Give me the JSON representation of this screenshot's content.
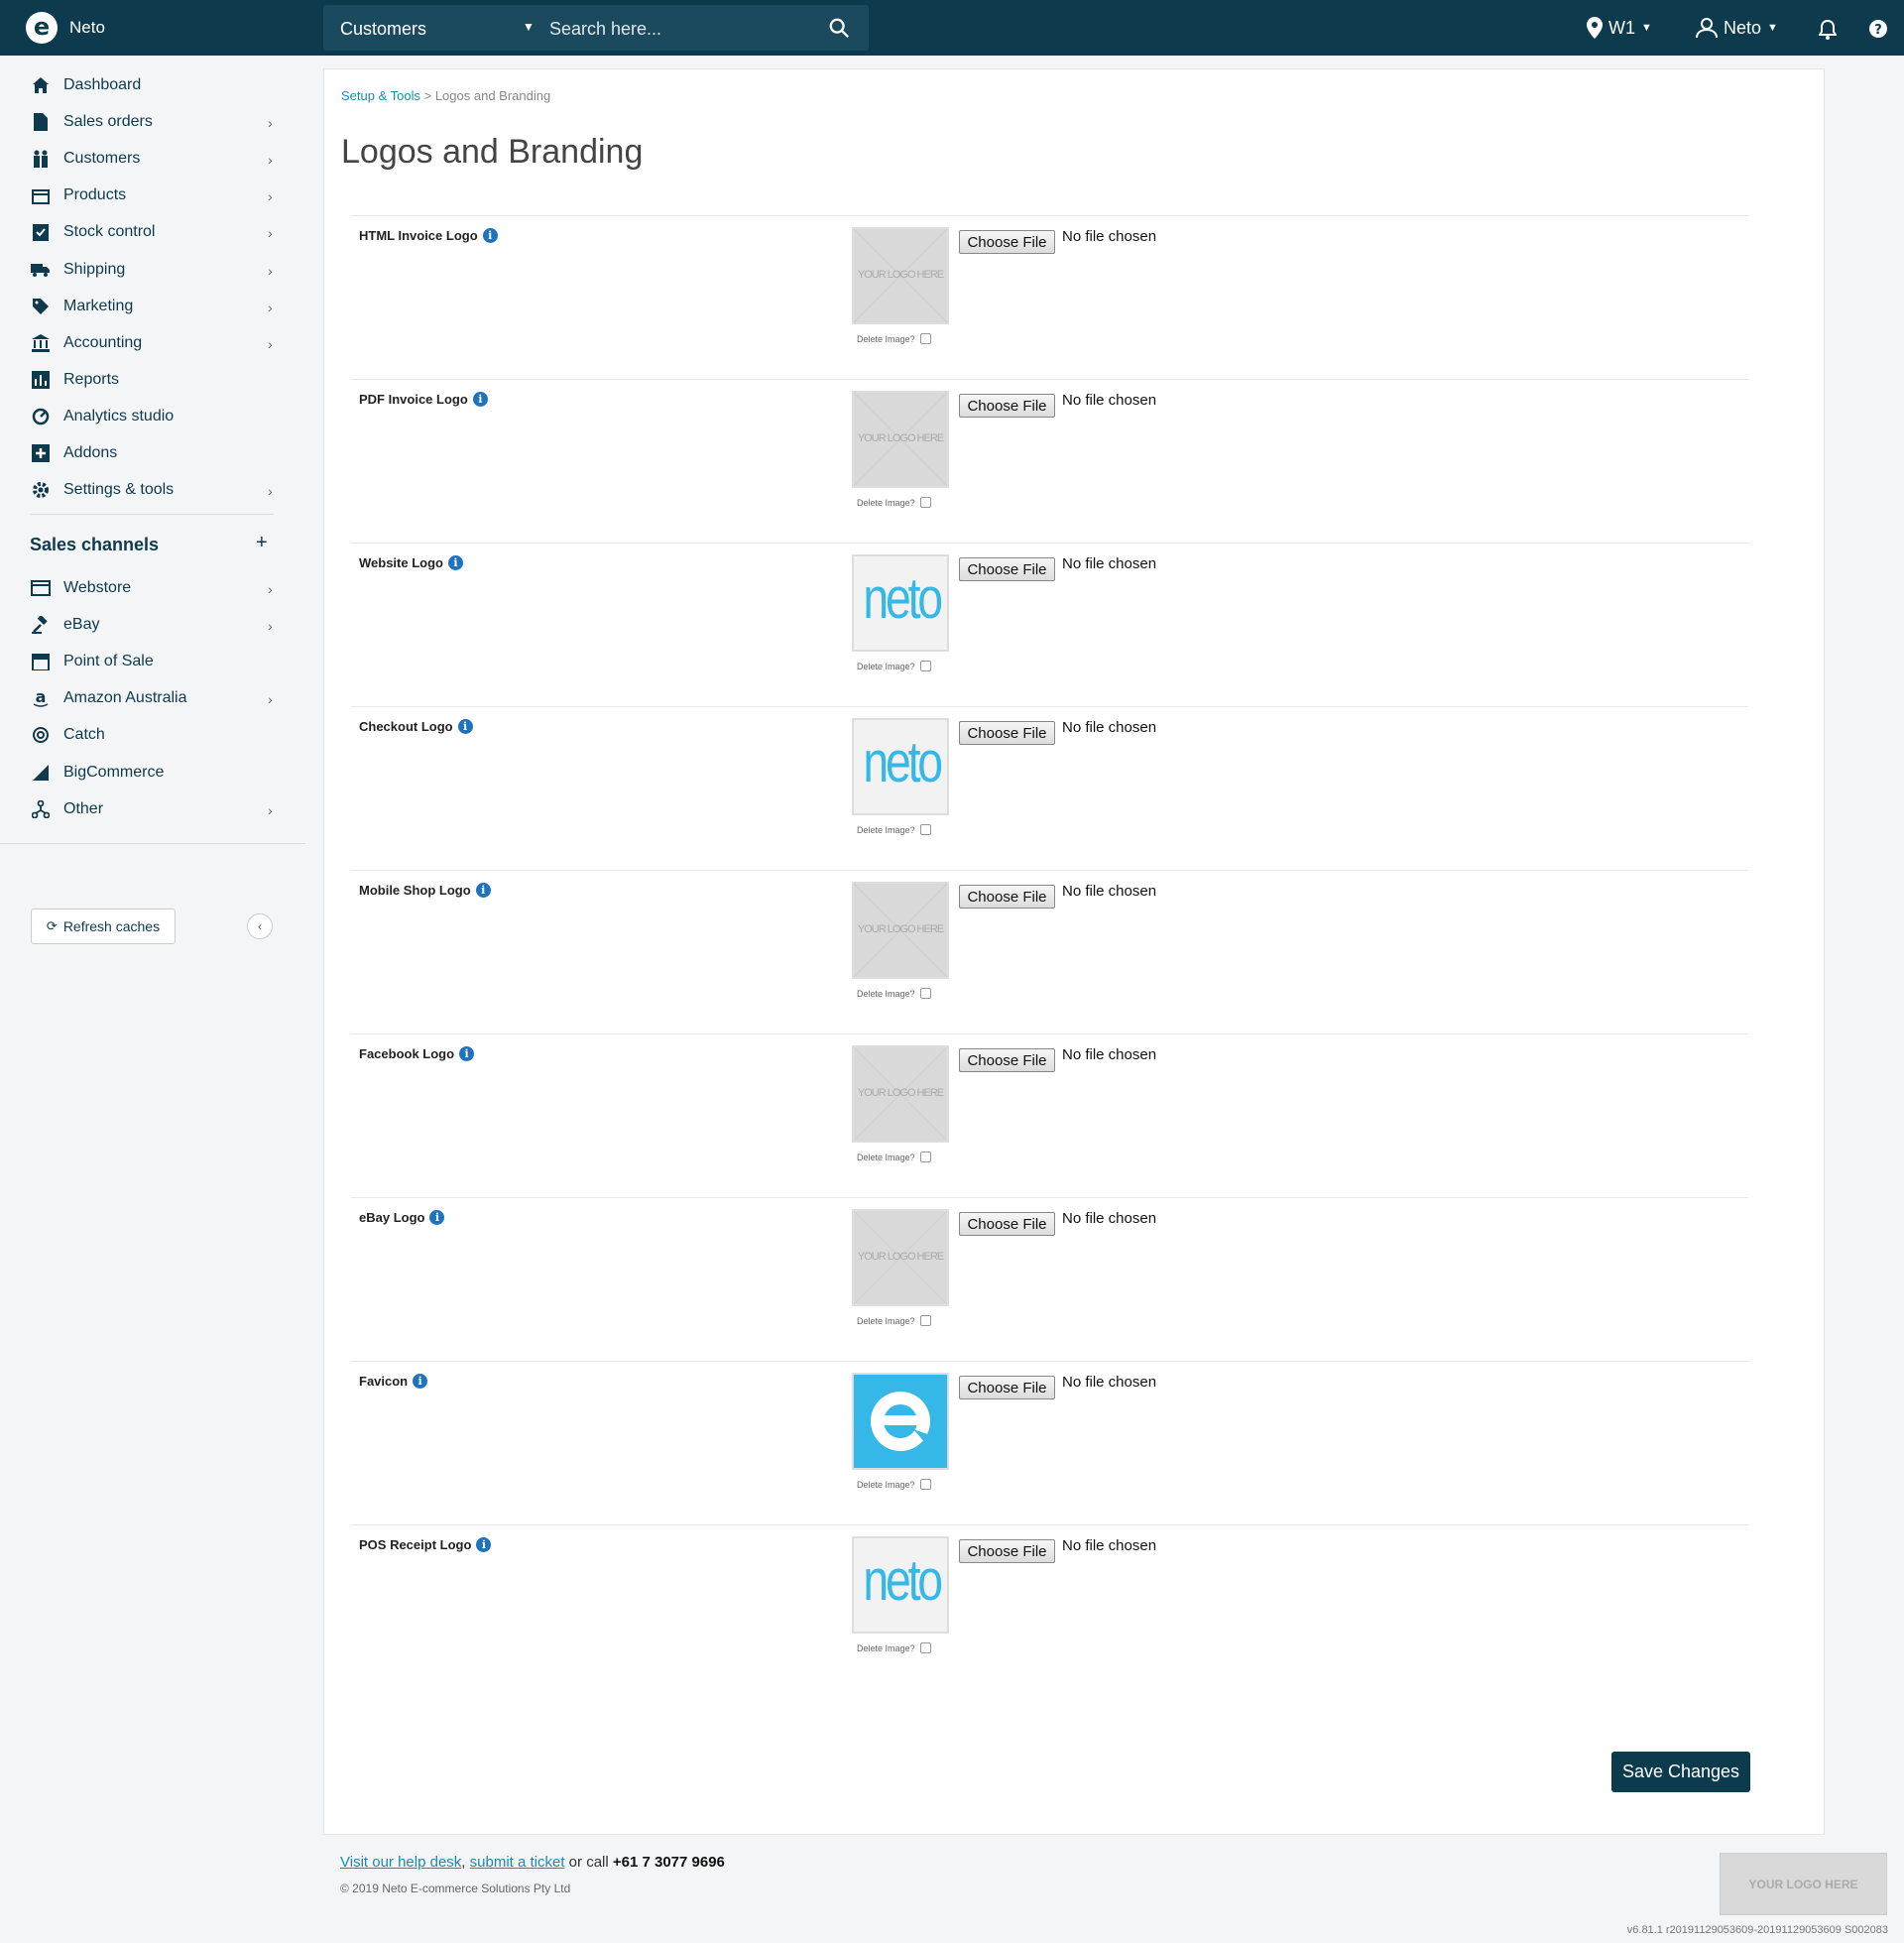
{
  "topbar": {
    "brand": "Neto",
    "search_scope": "Customers",
    "search_placeholder": "Search here...",
    "location": "W1",
    "user": "Neto"
  },
  "sidebar": {
    "items": [
      {
        "label": "Dashboard",
        "icon": "home-icon",
        "chevron": false
      },
      {
        "label": "Sales orders",
        "icon": "document-icon",
        "chevron": true
      },
      {
        "label": "Customers",
        "icon": "people-icon",
        "chevron": true
      },
      {
        "label": "Products",
        "icon": "box-icon",
        "chevron": true
      },
      {
        "label": "Stock control",
        "icon": "clipboard-check-icon",
        "chevron": true
      },
      {
        "label": "Shipping",
        "icon": "truck-icon",
        "chevron": true
      },
      {
        "label": "Marketing",
        "icon": "tag-icon",
        "chevron": true
      },
      {
        "label": "Accounting",
        "icon": "bank-icon",
        "chevron": true
      },
      {
        "label": "Reports",
        "icon": "bar-chart-icon",
        "chevron": false
      },
      {
        "label": "Analytics studio",
        "icon": "analytics-icon",
        "chevron": false
      },
      {
        "label": "Addons",
        "icon": "plus-square-icon",
        "chevron": false
      },
      {
        "label": "Settings & tools",
        "icon": "gear-icon",
        "chevron": true
      }
    ],
    "channels_title": "Sales channels",
    "channels": [
      {
        "label": "Webstore",
        "icon": "browser-icon",
        "chevron": true
      },
      {
        "label": "eBay",
        "icon": "gavel-icon",
        "chevron": true
      },
      {
        "label": "Point of Sale",
        "icon": "store-icon",
        "chevron": false
      },
      {
        "label": "Amazon Australia",
        "icon": "amazon-icon",
        "chevron": true
      },
      {
        "label": "Catch",
        "icon": "catch-icon",
        "chevron": false
      },
      {
        "label": "BigCommerce",
        "icon": "bigcommerce-icon",
        "chevron": false
      },
      {
        "label": "Other",
        "icon": "network-icon",
        "chevron": true
      }
    ],
    "refresh_label": "Refresh caches"
  },
  "breadcrumb": {
    "parent": "Setup & Tools",
    "separator": ">",
    "current": "Logos and Branding"
  },
  "page_title": "Logos and Branding",
  "file_button": "Choose File",
  "no_file": "No file chosen",
  "delete_label": "Delete Image?",
  "placeholder_text": "YOUR LOGO HERE",
  "neto_text": "neto",
  "logos": [
    {
      "label": "HTML Invoice Logo",
      "image": "placeholder"
    },
    {
      "label": "PDF Invoice Logo",
      "image": "placeholder"
    },
    {
      "label": "Website Logo",
      "image": "neto"
    },
    {
      "label": "Checkout Logo",
      "image": "neto"
    },
    {
      "label": "Mobile Shop Logo",
      "image": "placeholder"
    },
    {
      "label": "Facebook Logo",
      "image": "placeholder"
    },
    {
      "label": "eBay Logo",
      "image": "placeholder"
    },
    {
      "label": "Favicon",
      "image": "favicon"
    },
    {
      "label": "POS Receipt Logo",
      "image": "neto"
    }
  ],
  "save_label": "Save Changes",
  "footer": {
    "help_desk": "Visit our help desk",
    "comma": ",",
    "ticket": "submit a ticket",
    "or_call": " or call ",
    "phone": "+61 7 3077 9696",
    "copyright": "© 2019 Neto E-commerce Solutions Pty Ltd",
    "logo_text": "YOUR LOGO HERE",
    "version": "v6.81.1 r20191129053609-20191129053609 S002083"
  },
  "colors": {
    "primary": "#0e3a4e",
    "link": "#1e88b5",
    "neto_blue": "#35b7e8",
    "info": "#1e73be"
  }
}
